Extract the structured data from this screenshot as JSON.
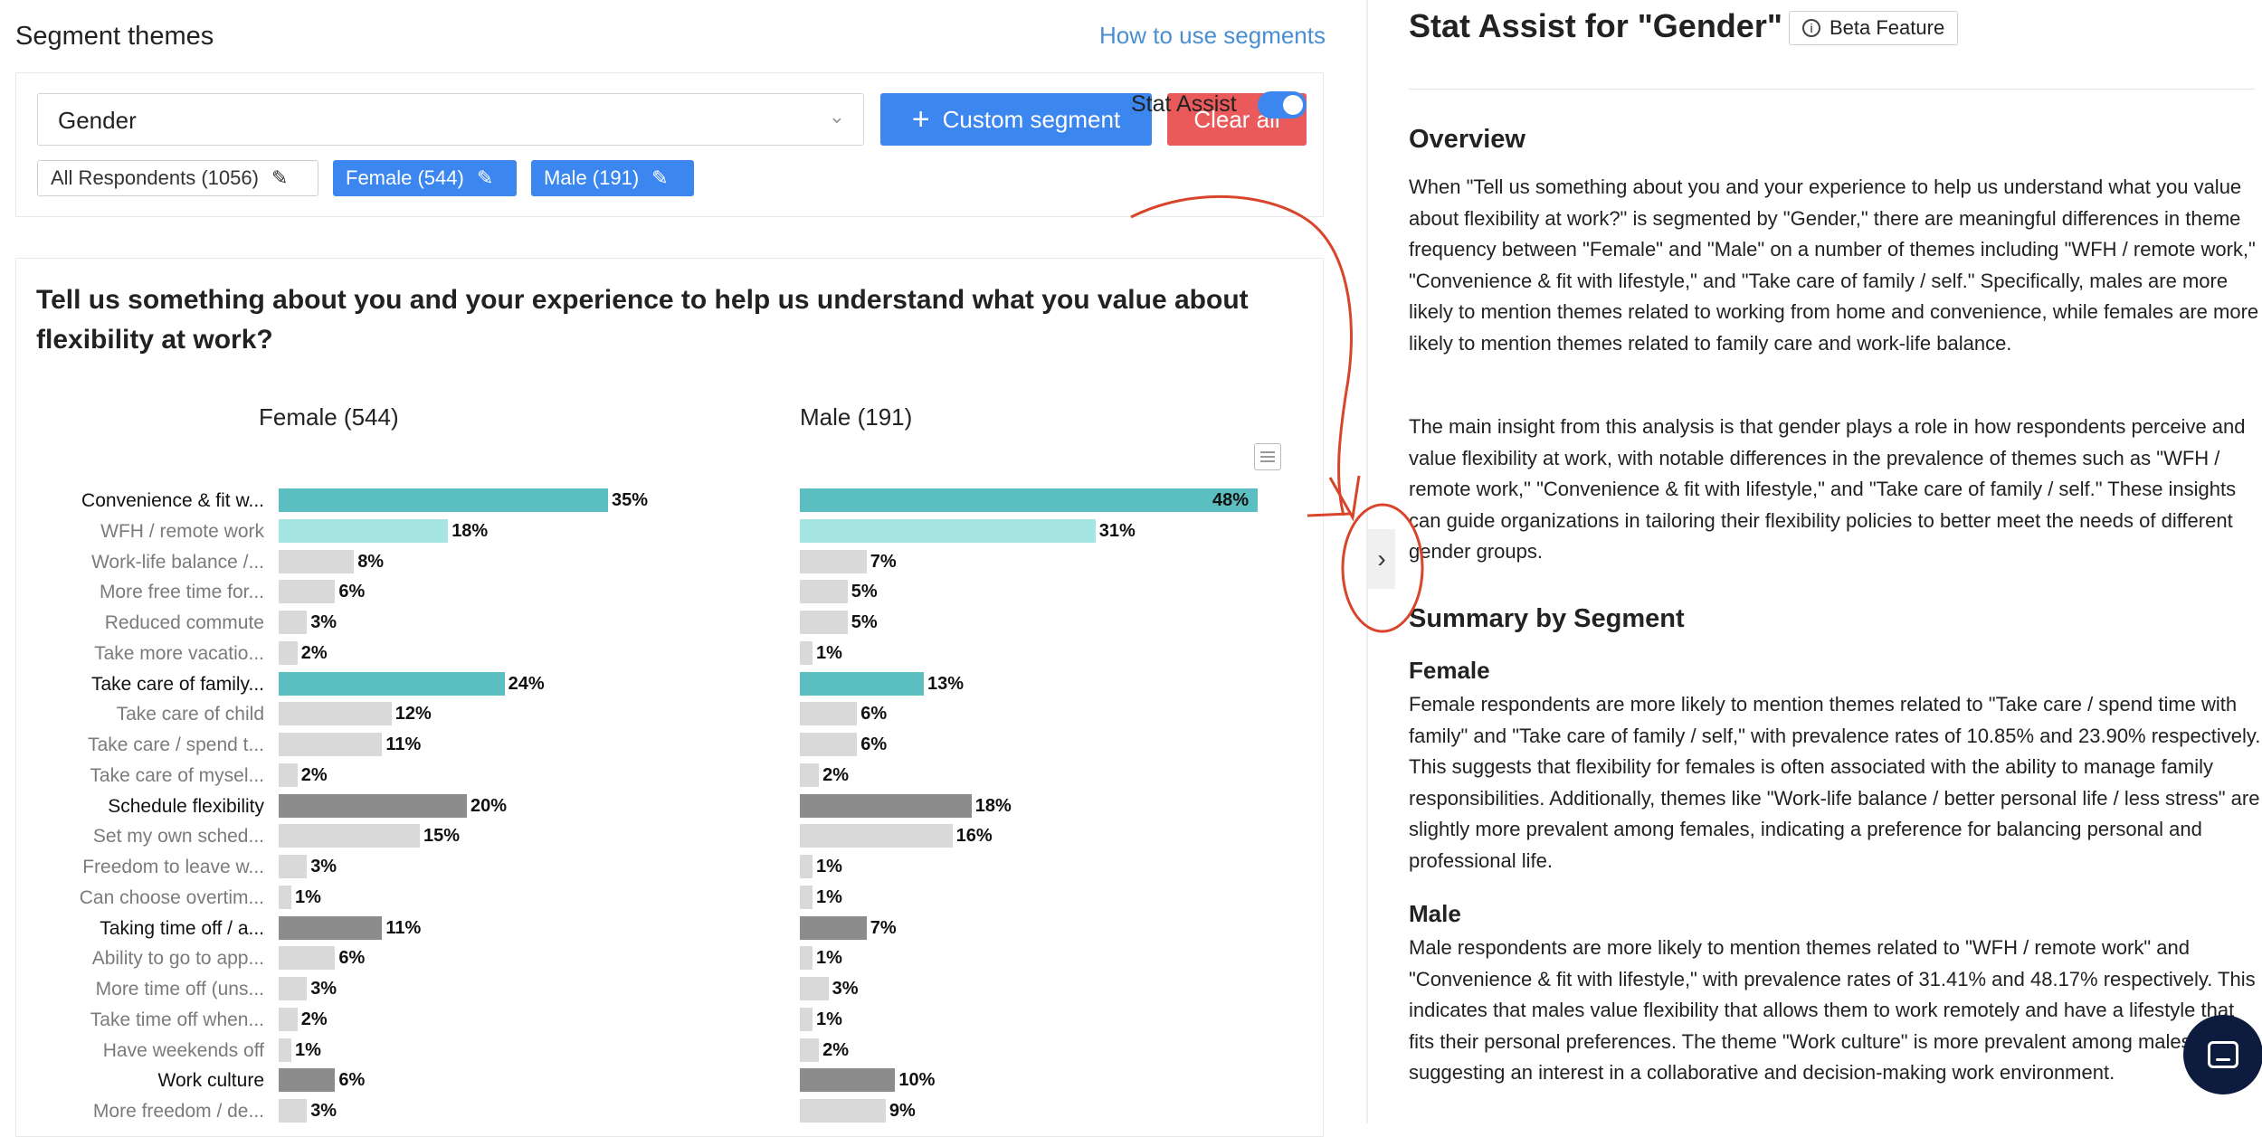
{
  "header": {
    "title": "Segment themes",
    "help_link": "How to use segments"
  },
  "filters": {
    "segment_select_value": "Gender",
    "custom_segment_label": "Custom segment",
    "clear_all_label": "Clear all",
    "chips": [
      "All Respondents (1056)",
      "Female (544)",
      "Male (191)"
    ],
    "stat_assist_label": "Stat Assist",
    "stat_assist_on": true
  },
  "question": "Tell us something about you and your experience to help us understand what you value about flexibility at work?",
  "chart_data": {
    "type": "bar",
    "series": [
      {
        "name": "Female (544)"
      },
      {
        "name": "Male (191)"
      }
    ],
    "rows": [
      {
        "label": "Convenience & fit w...",
        "level": "parent",
        "female": 35,
        "male": 48,
        "color": "#5bbfc2"
      },
      {
        "label": "WFH / remote work",
        "level": "child",
        "female": 18,
        "male": 31,
        "color": "#a6e6e2"
      },
      {
        "label": "Work-life balance /...",
        "level": "child",
        "female": 8,
        "male": 7,
        "color": "#d9d9d9"
      },
      {
        "label": "More free time for...",
        "level": "child",
        "female": 6,
        "male": 5,
        "color": "#d9d9d9"
      },
      {
        "label": "Reduced commute",
        "level": "child",
        "female": 3,
        "male": 5,
        "color": "#d9d9d9"
      },
      {
        "label": "Take more vacatio...",
        "level": "child",
        "female": 2,
        "male": 1,
        "color": "#d9d9d9"
      },
      {
        "label": "Take care of family...",
        "level": "parent",
        "female": 24,
        "male": 13,
        "color": "#5bbfc2"
      },
      {
        "label": "Take care of child",
        "level": "child",
        "female": 12,
        "male": 6,
        "color": "#d9d9d9"
      },
      {
        "label": "Take care / spend t...",
        "level": "child",
        "female": 11,
        "male": 6,
        "color": "#d9d9d9"
      },
      {
        "label": "Take care of mysel...",
        "level": "child",
        "female": 2,
        "male": 2,
        "color": "#d9d9d9"
      },
      {
        "label": "Schedule flexibility",
        "level": "parent",
        "female": 20,
        "male": 18,
        "color": "#8c8c8c"
      },
      {
        "label": "Set my own sched...",
        "level": "child",
        "female": 15,
        "male": 16,
        "color": "#d9d9d9"
      },
      {
        "label": "Freedom to leave w...",
        "level": "child",
        "female": 3,
        "male": 1,
        "color": "#d9d9d9"
      },
      {
        "label": "Can choose overtim...",
        "level": "child",
        "female": 1,
        "male": 1,
        "color": "#d9d9d9"
      },
      {
        "label": "Taking time off / a...",
        "level": "parent",
        "female": 11,
        "male": 7,
        "color": "#8c8c8c"
      },
      {
        "label": "Ability to go to app...",
        "level": "child",
        "female": 6,
        "male": 1,
        "color": "#d9d9d9"
      },
      {
        "label": "More time off (uns...",
        "level": "child",
        "female": 3,
        "male": 3,
        "color": "#d9d9d9"
      },
      {
        "label": "Take time off when...",
        "level": "child",
        "female": 2,
        "male": 1,
        "color": "#d9d9d9"
      },
      {
        "label": "Have weekends off",
        "level": "child",
        "female": 1,
        "male": 2,
        "color": "#d9d9d9"
      },
      {
        "label": "Work culture",
        "level": "parent",
        "female": 6,
        "male": 10,
        "color": "#8c8c8c"
      },
      {
        "label": "More freedom / de...",
        "level": "child",
        "female": 3,
        "male": 9,
        "color": "#d9d9d9"
      }
    ]
  },
  "stat_assist": {
    "title": "Stat Assist for \"Gender\"",
    "badge": "Beta Feature",
    "overview_heading": "Overview",
    "overview_p1": "When \"Tell us something about you and your experience to help us understand what you value about flexibility at work?\" is segmented by \"Gender,\" there are meaningful differences in theme frequency between \"Female\" and \"Male\" on a number of themes including \"WFH / remote work,\" \"Convenience & fit with lifestyle,\" and \"Take care of family / self.\" Specifically, males are more likely to mention themes related to working from home and convenience, while females are more likely to mention themes related to family care and work-life balance.",
    "overview_p2": "The main insight from this analysis is that gender plays a role in how respondents perceive and value flexibility at work, with notable differences in the prevalence of themes such as \"WFH / remote work,\" \"Convenience & fit with lifestyle,\" and \"Take care of family / self.\" These insights can guide organizations in tailoring their flexibility policies to better meet the needs of different gender groups.",
    "summary_heading": "Summary by Segment",
    "female_heading": "Female",
    "female_text": "Female respondents are more likely to mention themes related to \"Take care / spend time with family\" and \"Take care of family / self,\" with prevalence rates of 10.85% and 23.90% respectively. This suggests that flexibility for females is often associated with the ability to manage family responsibilities. Additionally, themes like \"Work-life balance / better personal life / less stress\" are slightly more prevalent among females, indicating a preference for balancing personal and professional life.",
    "male_heading": "Male",
    "male_text": "Male respondents are more likely to mention themes related to \"WFH / remote work\" and \"Convenience & fit with lifestyle,\" with prevalence rates of 31.41% and 48.17% respectively. This indicates that males value flexibility that allows them to work remotely and have a lifestyle that fits their personal preferences. The theme \"Work culture\" is more prevalent among males, suggesting an interest in a collaborative and decision-making work environment."
  },
  "colors": {
    "accent": "#3b86ef",
    "danger": "#ea5a5a",
    "annotation": "#d9452b",
    "chat": "#0d1b3e"
  }
}
